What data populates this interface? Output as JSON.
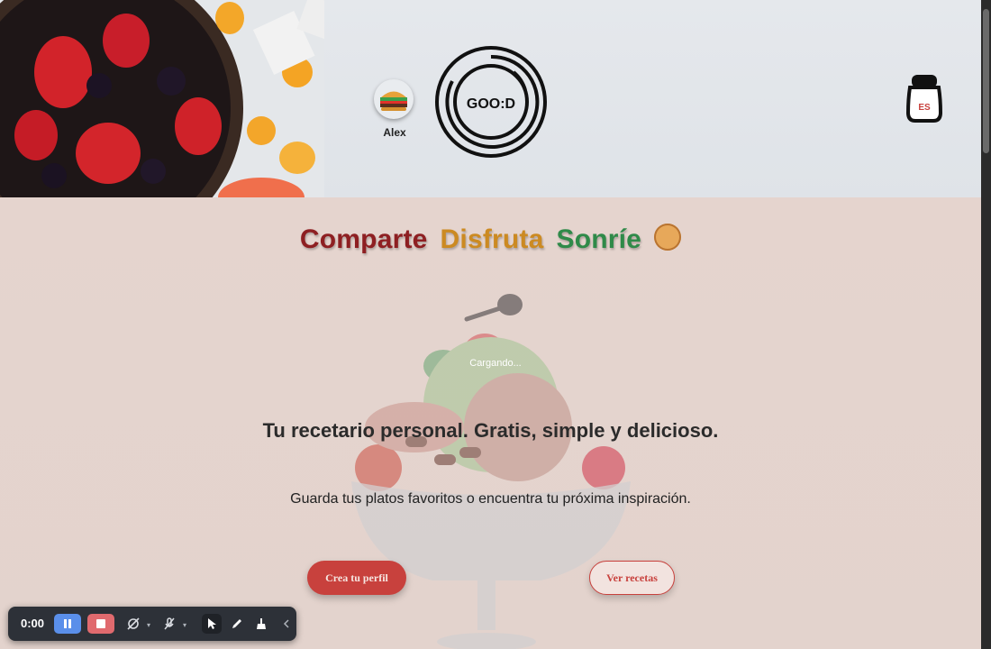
{
  "header": {
    "user_name": "Alex",
    "logo_text": "GOO:D",
    "language": "ES"
  },
  "tagline": {
    "word1": "Comparte",
    "word2": "Disfruta",
    "word3": "Sonríe"
  },
  "main": {
    "loading_text": "Cargando...",
    "headline": "Tu recetario personal. Gratis, simple y delicioso.",
    "subline": "Guarda tus platos favoritos o encuentra tu próxima inspiración.",
    "primary_button": "Crea tu perfil",
    "secondary_button": "Ver recetas"
  },
  "recorder": {
    "time": "0:00"
  },
  "colors": {
    "accent_red": "#c8413d",
    "tag_red": "#8e1f22",
    "tag_orange": "#cc8a22",
    "tag_green": "#2f8a49",
    "recorder_pause": "#5a8fea",
    "recorder_stop": "#e06a6e"
  },
  "icons": [
    "fruit-bowl-image",
    "burger-avatar-icon",
    "good-logo-icon",
    "salt-shaker-language-icon",
    "smile-icon",
    "ice-cream-bowl-illustration",
    "pause-icon",
    "stop-icon",
    "camera-off-icon",
    "mic-off-icon",
    "pointer-icon",
    "pen-icon",
    "broom-icon",
    "collapse-icon"
  ]
}
